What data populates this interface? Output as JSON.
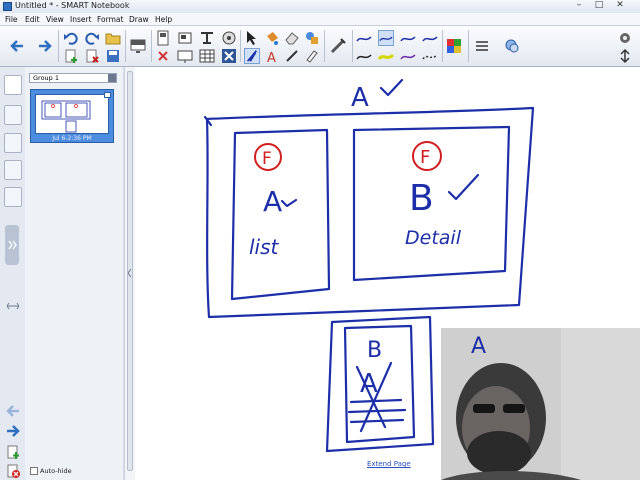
{
  "window": {
    "title": "Untitled * - SMART Notebook",
    "minimize": "–",
    "maximize": "□",
    "close": "✕"
  },
  "menu": {
    "items": [
      "File",
      "Edit",
      "View",
      "Insert",
      "Format",
      "Draw",
      "Help"
    ]
  },
  "toolbar": {
    "icons": [
      "back-icon",
      "forward-icon",
      "undo-icon",
      "redo-icon",
      "open-icon",
      "add-page-icon",
      "delete-icon",
      "save-icon",
      "screen-shade-icon",
      "show-tools-icon",
      "table-icon",
      "document-camera-icon",
      "full-screen-icon",
      "dual-page-icon",
      "capture-icon",
      "select-icon",
      "magic-pen-icon",
      "eraser-icon",
      "fill-icon",
      "pen-icon",
      "creative-pen-icon",
      "text-icon",
      "line-icon",
      "shape-icon",
      "color-palette-icon",
      "line-style-icon",
      "properties-icon",
      "settings-icon",
      "more-icon"
    ]
  },
  "sidebar": {
    "tabs": [
      "page-sorter-tab",
      "gallery-tab",
      "attachments-tab",
      "properties-tab",
      "addons-tab"
    ]
  },
  "page_sorter": {
    "group_label": "Group 1",
    "thumbnail_label": "Jul 6-2:36 PM",
    "auto_hide_label": "Auto-hide"
  },
  "canvas": {
    "extend_page_label": "Extend Page",
    "handwriting": {
      "top_label": "A",
      "left_mark": "F",
      "left_letter": "A",
      "left_word": "list",
      "right_mark": "F",
      "right_letter": "B",
      "right_word": "Detail",
      "bottom_letter": "B",
      "bottom_crossed": "A",
      "webcam_letter": "A"
    }
  },
  "colors": {
    "ink": "#1c2fa8",
    "red_ink": "#d11e1e",
    "accent": "#2f6fc0"
  }
}
